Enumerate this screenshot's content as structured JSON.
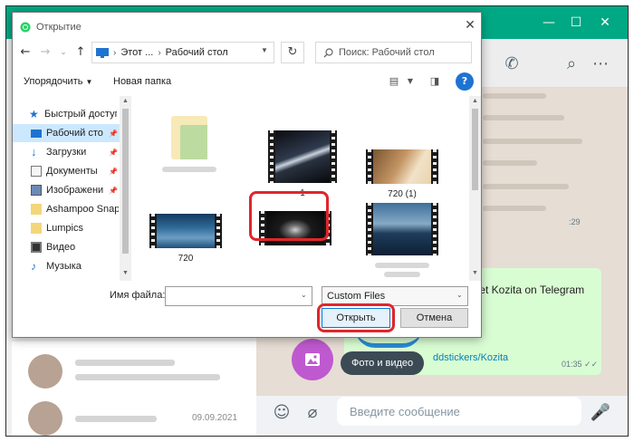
{
  "colors": {
    "whatsapp_green": "#00a884",
    "highlight_red": "#e0262b",
    "attach_purple": "#bf59cf",
    "link_blue": "#027eb5",
    "focus_blue": "#0078d7"
  },
  "whatsapp": {
    "window_controls": {
      "minimize": "—",
      "maximize": "☐",
      "close": "✕"
    },
    "header_icons": [
      "phone-icon",
      "search-icon",
      "more-icon"
    ],
    "message": {
      "text": "r set Kozita on Telegram",
      "link": "ddstickers/Kozita",
      "time": "01:35"
    },
    "side_time": ":29",
    "attach_tooltip": "Фото и видео",
    "input_placeholder": "Введите сообщение",
    "chat_list": {
      "date": "09.09.2021"
    }
  },
  "dialog": {
    "title": "Открытие",
    "breadcrumbs": [
      "Этот ...",
      "Рабочий стол"
    ],
    "search_placeholder": "Поиск: Рабочий стол",
    "toolbar": {
      "organize": "Упорядочить",
      "new_folder": "Новая папка"
    },
    "nav_items": [
      {
        "label": "Быстрый доступ",
        "icon": "star-icon",
        "pinned": false,
        "selected": false
      },
      {
        "label": "Рабочий сто",
        "icon": "desktop-icon",
        "pinned": true,
        "selected": true
      },
      {
        "label": "Загрузки",
        "icon": "download-icon",
        "pinned": true,
        "selected": false
      },
      {
        "label": "Документы",
        "icon": "documents-icon",
        "pinned": true,
        "selected": false
      },
      {
        "label": "Изображени",
        "icon": "pictures-icon",
        "pinned": true,
        "selected": false
      },
      {
        "label": "Ashampoo Snap",
        "icon": "folder-icon",
        "pinned": false,
        "selected": false
      },
      {
        "label": "Lumpics",
        "icon": "folder-icon",
        "pinned": false,
        "selected": false
      },
      {
        "label": "Видео",
        "icon": "video-icon",
        "pinned": false,
        "selected": false
      },
      {
        "label": "Музыка",
        "icon": "music-icon",
        "pinned": false,
        "selected": false
      }
    ],
    "files": [
      {
        "name": "",
        "kind": "folder"
      },
      {
        "name": "1",
        "kind": "video"
      },
      {
        "name": "720 (1)",
        "kind": "video"
      },
      {
        "name": "720",
        "kind": "video"
      },
      {
        "name": "",
        "kind": "video",
        "highlighted": true
      },
      {
        "name": "",
        "kind": "video"
      }
    ],
    "filename_label": "Имя файла:",
    "filename_value": "",
    "filetype": "Custom Files",
    "open_label": "Открыть",
    "cancel_label": "Отмена"
  }
}
